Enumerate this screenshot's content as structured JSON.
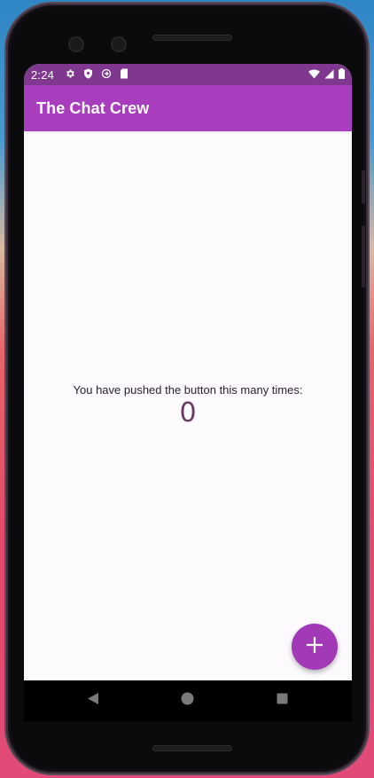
{
  "status_bar": {
    "time": "2:24",
    "left_icons": [
      "gear-icon",
      "shield-icon",
      "sync-icon",
      "sd-card-icon"
    ],
    "right_icons": [
      "wifi-icon",
      "signal-icon",
      "battery-icon"
    ]
  },
  "app_bar": {
    "title": "The Chat Crew",
    "color": "#a83dbd"
  },
  "main": {
    "counter_label": "You have pushed the button this many times:",
    "counter_value": "0"
  },
  "fab": {
    "icon": "plus-icon",
    "label": "+",
    "color": "#a23ab8"
  },
  "nav_bar": {
    "buttons": [
      "back-icon",
      "home-icon",
      "recents-icon"
    ]
  }
}
